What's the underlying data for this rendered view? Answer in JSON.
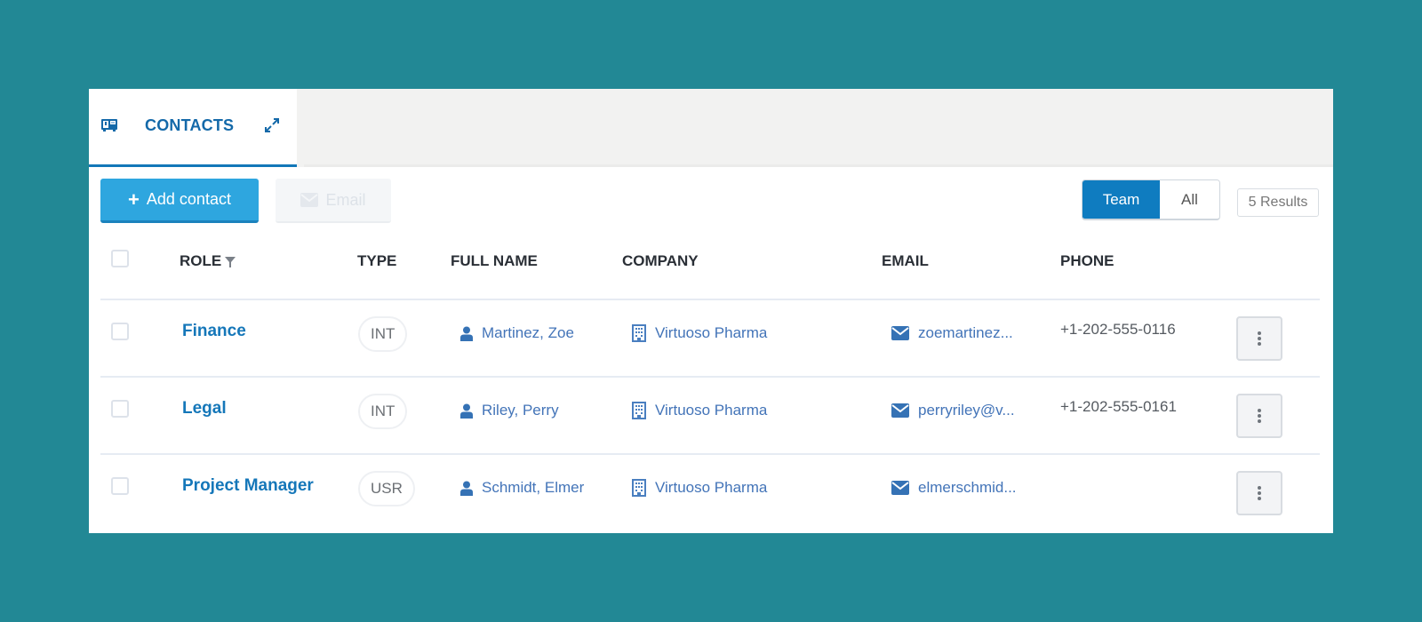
{
  "tab": {
    "label": "CONTACTS",
    "icon": "contact-card-icon",
    "expand_icon": "expand-icon"
  },
  "toolbar": {
    "add_label": "Add contact",
    "add_icon": "plus-icon",
    "email_label": "Email",
    "email_icon": "envelope-icon",
    "scope_options": [
      "Team",
      "All"
    ],
    "scope_selected": "Team",
    "results": "5 Results"
  },
  "colors": {
    "background": "#228895",
    "accent": "#0f7cc0",
    "add_button": "#2ea6df",
    "link": "#1577b9"
  },
  "table": {
    "columns": {
      "role": "ROLE",
      "type": "TYPE",
      "full_name": "FULL NAME",
      "company": "COMPANY",
      "email": "EMAIL",
      "phone": "PHONE"
    },
    "rows": [
      {
        "role": "Finance",
        "type": "INT",
        "full_name": "Martinez, Zoe",
        "company": "Virtuoso Pharma",
        "email": "zoemartinez...",
        "phone": "+1-202-555-0116"
      },
      {
        "role": "Legal",
        "type": "INT",
        "full_name": "Riley, Perry",
        "company": "Virtuoso Pharma",
        "email": "perryriley@v...",
        "phone": "+1-202-555-0161"
      },
      {
        "role": "Project Manager",
        "type": "USR",
        "full_name": "Schmidt, Elmer",
        "company": "Virtuoso Pharma",
        "email": "elmerschmid...",
        "phone": ""
      }
    ]
  }
}
